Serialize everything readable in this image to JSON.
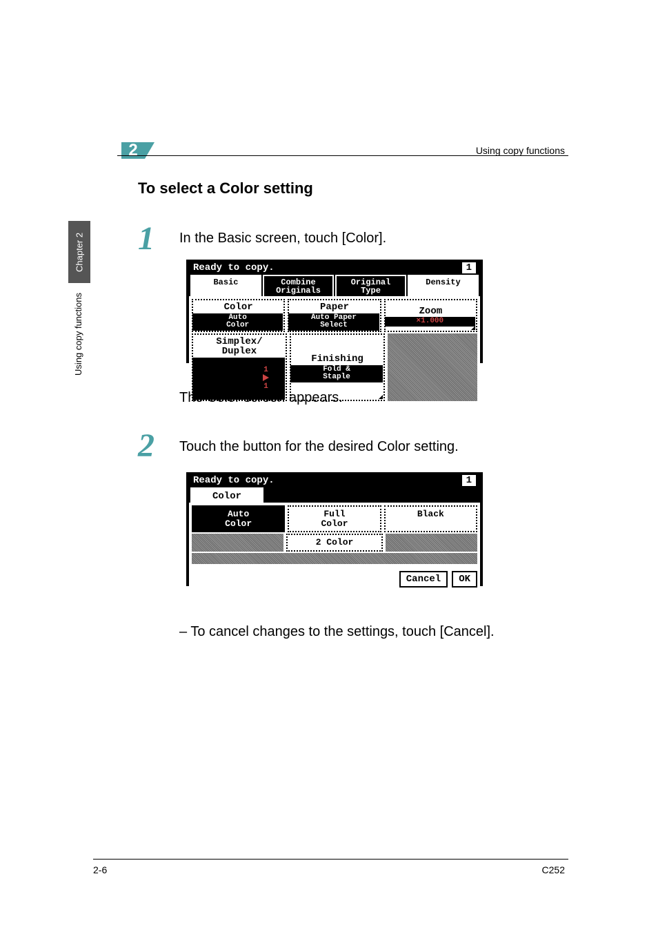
{
  "header": {
    "chapter_number": "2",
    "running_title": "Using copy functions"
  },
  "side": {
    "tab": "Chapter 2",
    "label": "Using copy functions"
  },
  "section_title": "To select a Color setting",
  "steps": {
    "s1": {
      "num": "1",
      "text": "In the Basic screen, touch [Color].",
      "after": "The Color screen appears."
    },
    "s2": {
      "num": "2",
      "text": "Touch the button for the desired Color setting.",
      "note": "– To cancel changes to the settings, touch [Cancel]."
    }
  },
  "lcd1": {
    "status": "Ready to copy.",
    "counter": "1",
    "tabs": {
      "basic": "Basic",
      "combine": "Combine\nOriginals",
      "original": "Original\nType",
      "density": "Density"
    },
    "btns": {
      "color": "Color",
      "color_sub": "Auto\nColor",
      "paper": "Paper",
      "paper_sub": "Auto Paper\nSelect",
      "zoom": "Zoom",
      "zoom_sub": "×1.000",
      "simplex": "Simplex/\nDuplex",
      "simplex_sub_l": "1",
      "simplex_sub_r": "1",
      "finishing": "Finishing",
      "finishing_sub": "Fold &\nStaple"
    }
  },
  "lcd2": {
    "status": "Ready to copy.",
    "counter": "1",
    "tab": "Color",
    "opts": {
      "auto": "Auto\nColor",
      "full": "Full\nColor",
      "black": "Black",
      "two": "2 Color"
    },
    "cancel": "Cancel",
    "ok": "OK"
  },
  "footer": {
    "left": "2-6",
    "right": "C252"
  }
}
